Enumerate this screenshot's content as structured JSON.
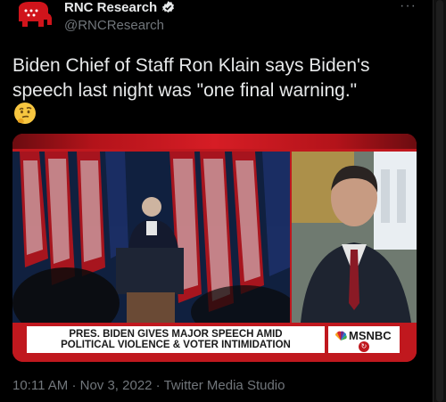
{
  "author": {
    "name": "RNC Research",
    "handle": "@RNCResearch",
    "verified_color": "#e7e9ea",
    "avatar_color": "#d0141b"
  },
  "more_label": "···",
  "tweet": {
    "line1": "Biden Chief of Staff Ron Klain says Biden's",
    "line2": "speech last night was \"one final warning.\"",
    "emoji": "thinking-face"
  },
  "video": {
    "lower_third_line1": "PRES. BIDEN GIVES MAJOR SPEECH AMID",
    "lower_third_line2": "POLITICAL VIOLENCE & VOTER INTIMIDATION",
    "network": "MSNBC"
  },
  "meta": {
    "time": "10:11 AM",
    "date": "Nov 3, 2022",
    "source": "Twitter Media Studio",
    "separator": "·"
  }
}
